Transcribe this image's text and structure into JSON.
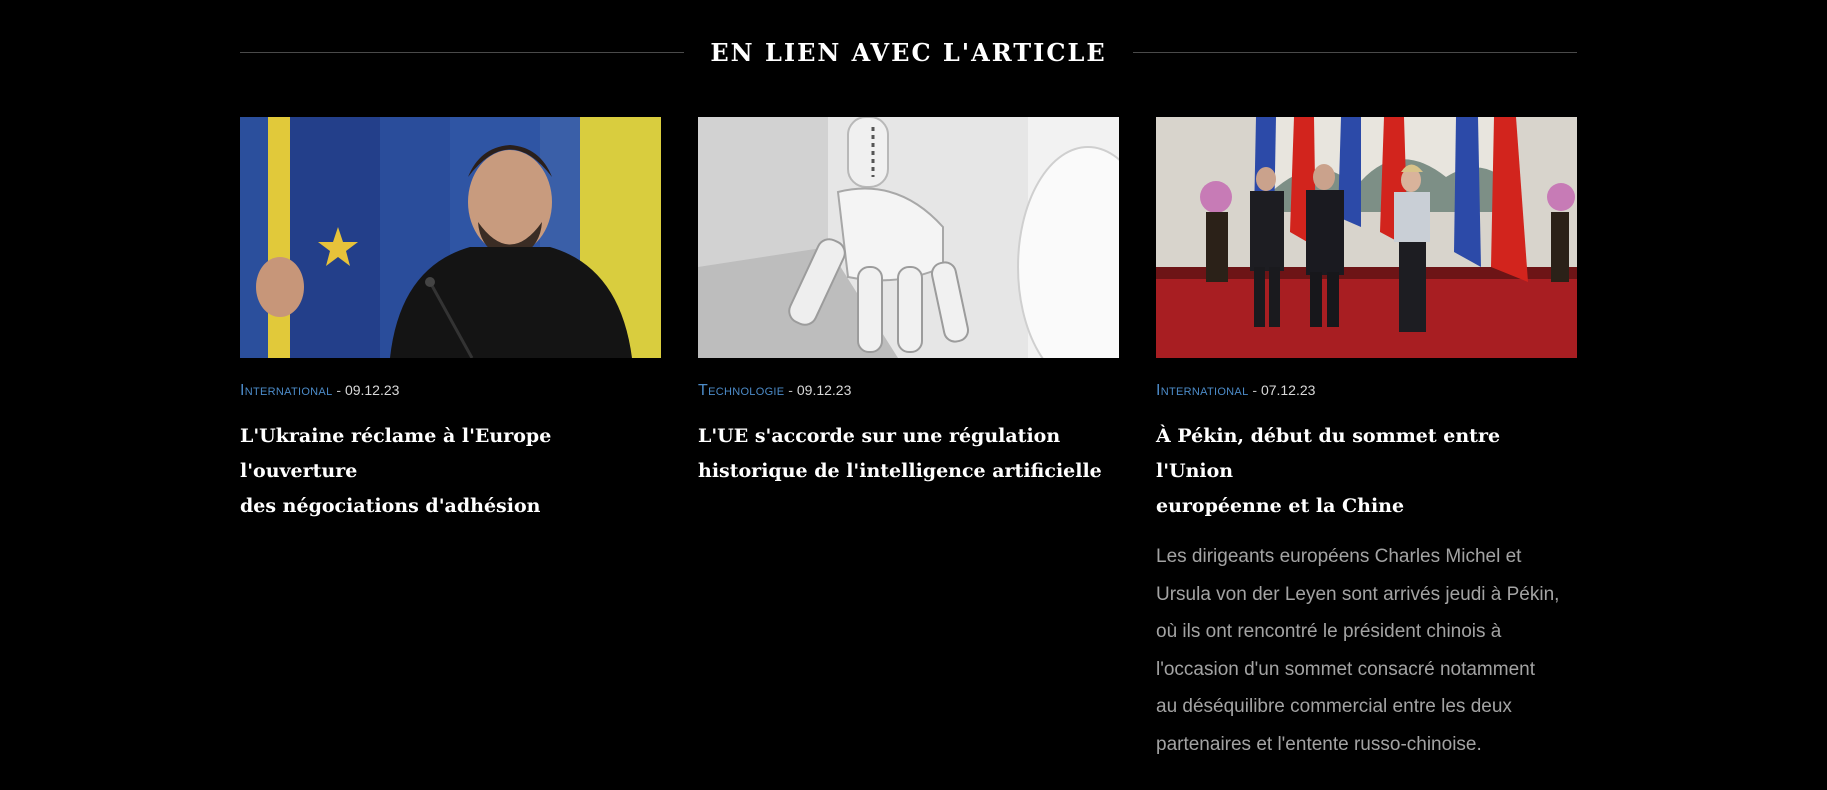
{
  "section": {
    "title": "EN LIEN AVEC L'ARTICLE"
  },
  "articles": [
    {
      "category": "International",
      "separator": " - ",
      "date": "09.12.23",
      "headline_line1": "L'Ukraine réclame à l'Europe l'ouverture",
      "headline_line2": "des négociations d'adhésion"
    },
    {
      "category": "Technologie",
      "separator": " - ",
      "date": "09.12.23",
      "headline_line1": "L'UE s'accorde sur une régulation",
      "headline_line2": "historique de l'intelligence artificielle"
    },
    {
      "category": "International",
      "separator": " - ",
      "date": "07.12.23",
      "headline_line1": "À Pékin, début du sommet entre l'Union",
      "headline_line2": "européenne et la Chine",
      "summary_lines": [
        "Les dirigeants européens Charles Michel et",
        "Ursula von der Leyen sont arrivés jeudi à Pékin,",
        "où ils ont rencontré le président chinois à",
        "l'occasion d'un sommet consacré notamment",
        "au déséquilibre commercial entre les deux",
        "partenaires et l'entente russo-chinoise."
      ]
    }
  ],
  "colors": {
    "background": "#000000",
    "category_link": "#4c8bc8",
    "summary_text": "#a3a3a3",
    "rule": "#4a4a4a"
  }
}
